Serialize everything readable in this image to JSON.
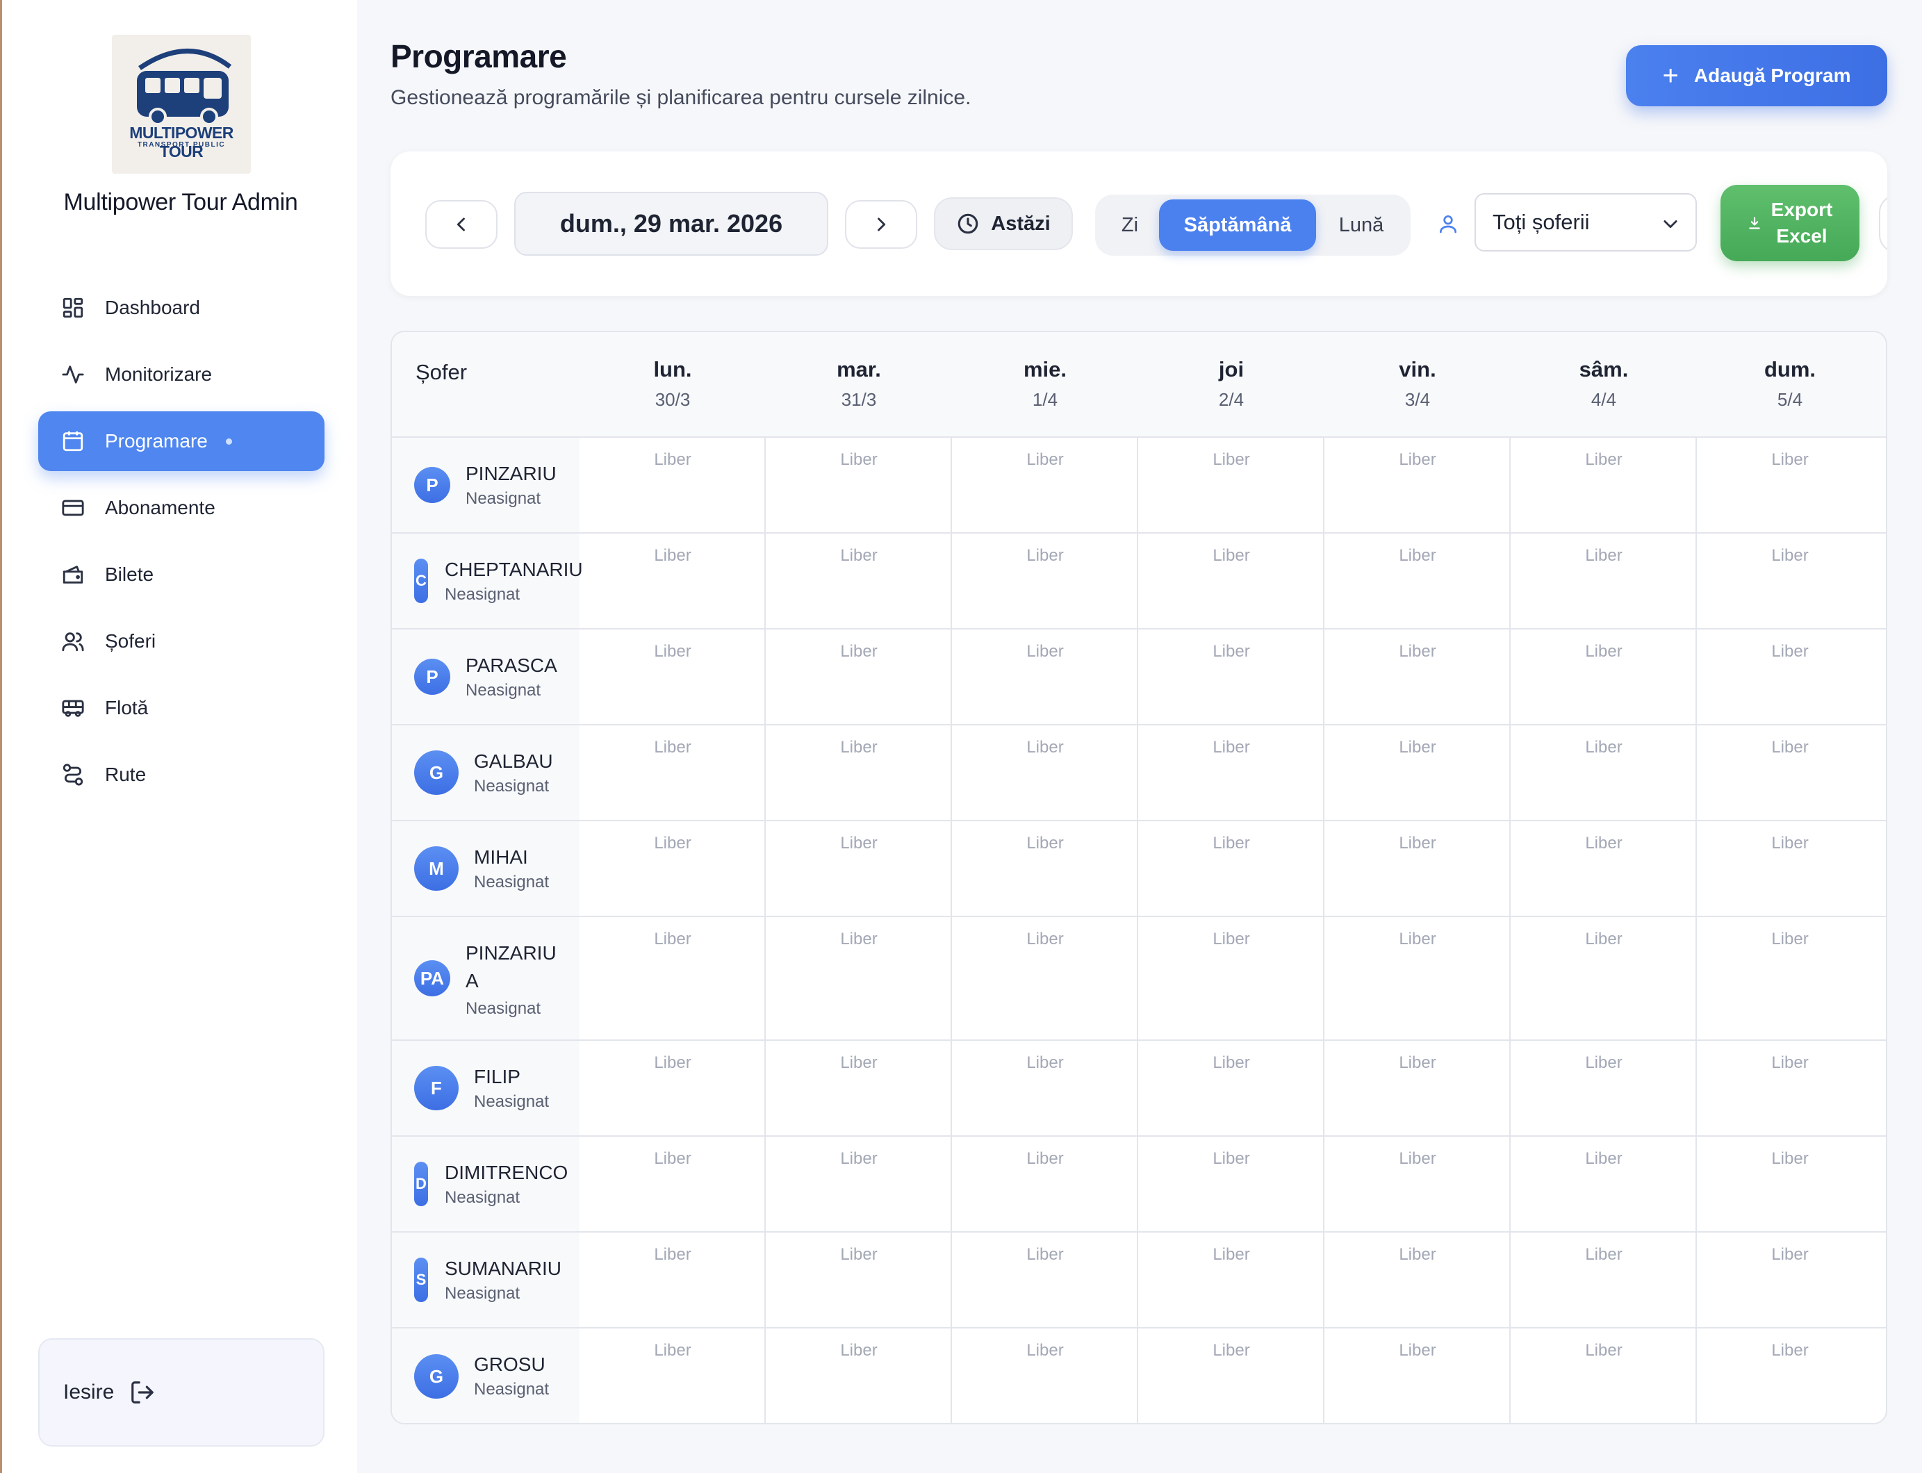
{
  "sidebar": {
    "logo": {
      "title": "MULTIPOWER TOUR",
      "subtitle": "TRANSPORT PUBLIC"
    },
    "brand": "Multipower Tour Admin",
    "items": [
      {
        "label": "Dashboard",
        "icon": "dashboard-icon"
      },
      {
        "label": "Monitorizare",
        "icon": "activity-icon"
      },
      {
        "label": "Programare",
        "icon": "calendar-icon",
        "active": true
      },
      {
        "label": "Abonamente",
        "icon": "credit-card-icon"
      },
      {
        "label": "Bilete",
        "icon": "wallet-icon"
      },
      {
        "label": "Șoferi",
        "icon": "users-icon"
      },
      {
        "label": "Flotă",
        "icon": "bus-icon"
      },
      {
        "label": "Rute",
        "icon": "route-icon"
      }
    ],
    "logout": "Iesire"
  },
  "header": {
    "title": "Programare",
    "subtitle": "Gestionează programările și planificarea pentru cursele zilnice.",
    "add_button": "Adaugă Program"
  },
  "toolbar": {
    "date": "dum., 29 mar. 2026",
    "today": "Astăzi",
    "views": [
      "Zi",
      "Săptămână",
      "Lună"
    ],
    "active_view": "Săptămână",
    "driver_filter": "Toți șoferii",
    "export": [
      "Export",
      "Excel"
    ]
  },
  "table": {
    "driver_header": "Șofer",
    "days": [
      {
        "day": "lun.",
        "date": "30/3"
      },
      {
        "day": "mar.",
        "date": "31/3"
      },
      {
        "day": "mie.",
        "date": "1/4"
      },
      {
        "day": "joi",
        "date": "2/4"
      },
      {
        "day": "vin.",
        "date": "3/4"
      },
      {
        "day": "sâm.",
        "date": "4/4"
      },
      {
        "day": "dum.",
        "date": "5/4"
      }
    ],
    "free_label": "Liber",
    "drivers": [
      {
        "initials": "P",
        "name": "PINZARIU",
        "status": "Neasignat"
      },
      {
        "initials": "C",
        "name": "CHEPTANARIU",
        "status": "Neasignat"
      },
      {
        "initials": "P",
        "name": "PARASCA",
        "status": "Neasignat"
      },
      {
        "initials": "G",
        "name": "GALBAU",
        "status": "Neasignat"
      },
      {
        "initials": "M",
        "name": "MIHAI",
        "status": "Neasignat"
      },
      {
        "initials": "PA",
        "name": "PINZARIU",
        "name2": "A",
        "status": "Neasignat"
      },
      {
        "initials": "F",
        "name": "FILIP",
        "status": "Neasignat"
      },
      {
        "initials": "D",
        "name": "DIMITRENCO",
        "status": "Neasignat"
      },
      {
        "initials": "S",
        "name": "SUMANARIU",
        "status": "Neasignat"
      },
      {
        "initials": "G",
        "name": "GROSU",
        "status": "Neasignat"
      }
    ]
  },
  "colors": {
    "accent": "#4b80ef",
    "export": "#4fb45f",
    "free_text": "#a3a8b5"
  }
}
